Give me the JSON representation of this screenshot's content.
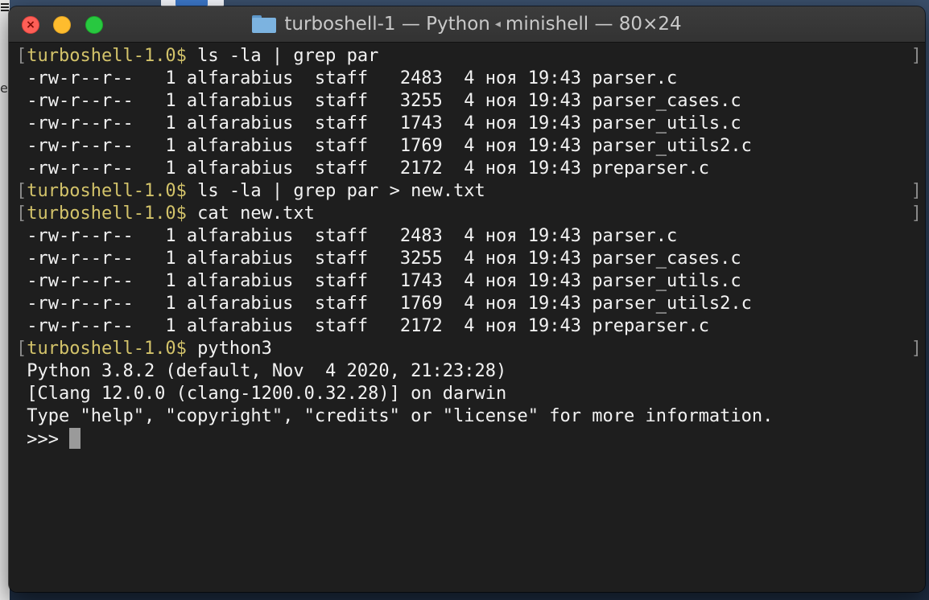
{
  "window": {
    "title_left": "turboshell-1 — Python",
    "title_right": "minishell — 80×24",
    "title_separator": "◂"
  },
  "terminal": {
    "prompt_open": "[",
    "prompt": "turboshell-1.0$",
    "prompt_close": "]",
    "cmd1": " ls -la | grep par",
    "cmd2": " ls -la | grep par > new.txt",
    "cmd3": " cat new.txt",
    "cmd4": " python3",
    "listing1": [
      " -rw-r--r--   1 alfarabius  staff   2483  4 ноя 19:43 parser.c",
      " -rw-r--r--   1 alfarabius  staff   3255  4 ноя 19:43 parser_cases.c",
      " -rw-r--r--   1 alfarabius  staff   1743  4 ноя 19:43 parser_utils.c",
      " -rw-r--r--   1 alfarabius  staff   1769  4 ноя 19:43 parser_utils2.c",
      " -rw-r--r--   1 alfarabius  staff   2172  4 ноя 19:43 preparser.c"
    ],
    "listing2": [
      " -rw-r--r--   1 alfarabius  staff   2483  4 ноя 19:43 parser.c",
      " -rw-r--r--   1 alfarabius  staff   3255  4 ноя 19:43 parser_cases.c",
      " -rw-r--r--   1 alfarabius  staff   1743  4 ноя 19:43 parser_utils.c",
      " -rw-r--r--   1 alfarabius  staff   1769  4 ноя 19:43 parser_utils2.c",
      " -rw-r--r--   1 alfarabius  staff   2172  4 ноя 19:43 preparser.c"
    ],
    "python_banner": [
      " Python 3.8.2 (default, Nov  4 2020, 21:23:28)",
      " [Clang 12.0.0 (clang-1200.0.32.28)] on darwin",
      " Type \"help\", \"copyright\", \"credits\" or \"license\" for more information."
    ],
    "repl_prompt": " >>> "
  },
  "colors": {
    "prompt": "#d3c36a",
    "text": "#f2f2f2",
    "background": "#1e1e1e"
  }
}
